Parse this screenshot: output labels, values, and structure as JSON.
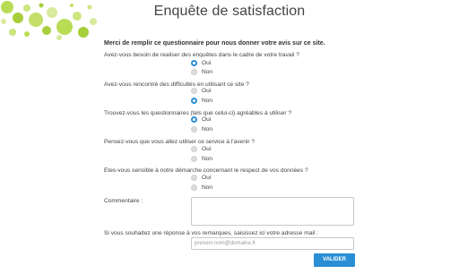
{
  "header": {
    "title": "Enquête de satisfaction"
  },
  "intro": "Merci de remplir ce questionnaire pour nous donner votre avis sur ce site.",
  "questions": [
    {
      "text": "Avez-vous besoin de realiser des enquêtes dans le cadre de votre travail ?",
      "options": [
        {
          "label": "Oui",
          "selected": true
        },
        {
          "label": "Non",
          "selected": false
        }
      ]
    },
    {
      "text": "Avez-vous rencontré des difficultés en utilisant ce site ?",
      "options": [
        {
          "label": "Oui",
          "selected": false
        },
        {
          "label": "Non",
          "selected": true
        }
      ]
    },
    {
      "text": "Trouvez-vous les questionnaires (tels que celui-ci) agréables à utiliser ?",
      "options": [
        {
          "label": "Oui",
          "selected": true
        },
        {
          "label": "Non",
          "selected": false
        }
      ]
    },
    {
      "text": "Pensez-vous que vous allez utiliser ce service à l'avenir ?",
      "options": [
        {
          "label": "Oui",
          "selected": false
        },
        {
          "label": "Non",
          "selected": false
        }
      ]
    },
    {
      "text": "Etes-vous sensible à notre démarche concernant le respect de vos données ?",
      "options": [
        {
          "label": "Oui",
          "selected": false
        },
        {
          "label": "Non",
          "selected": false
        }
      ]
    }
  ],
  "comment": {
    "label": "Commentaire :",
    "value": ""
  },
  "email": {
    "label": "Si vous souhaitez une réponse à vos remarques, saisissez ici votre adresse mail :",
    "placeholder": "prenom.nom@domaine.fr"
  },
  "submit_label": "VALIDER",
  "colors": {
    "accent": "#2a8fd4",
    "bubble_green": "#a6cf3a",
    "bubble_light": "#d8ea9b"
  }
}
